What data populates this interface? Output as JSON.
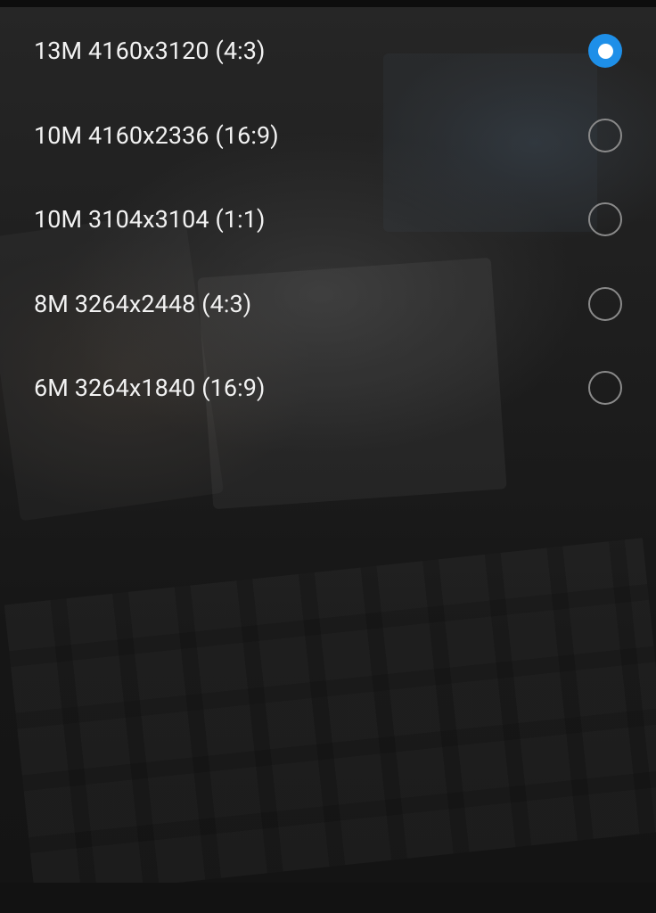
{
  "resolution_options": [
    {
      "label": "13M 4160x3120 (4:3)",
      "selected": true
    },
    {
      "label": "10M 4160x2336 (16:9)",
      "selected": false
    },
    {
      "label": "10M 3104x3104 (1:1)",
      "selected": false
    },
    {
      "label": "8M 3264x2448 (4:3)",
      "selected": false
    },
    {
      "label": "6M 3264x1840 (16:9)",
      "selected": false
    }
  ],
  "colors": {
    "accent": "#1e8fe8",
    "text": "#f2f2f2",
    "radio_unchecked_border": "#8a8a8a"
  }
}
